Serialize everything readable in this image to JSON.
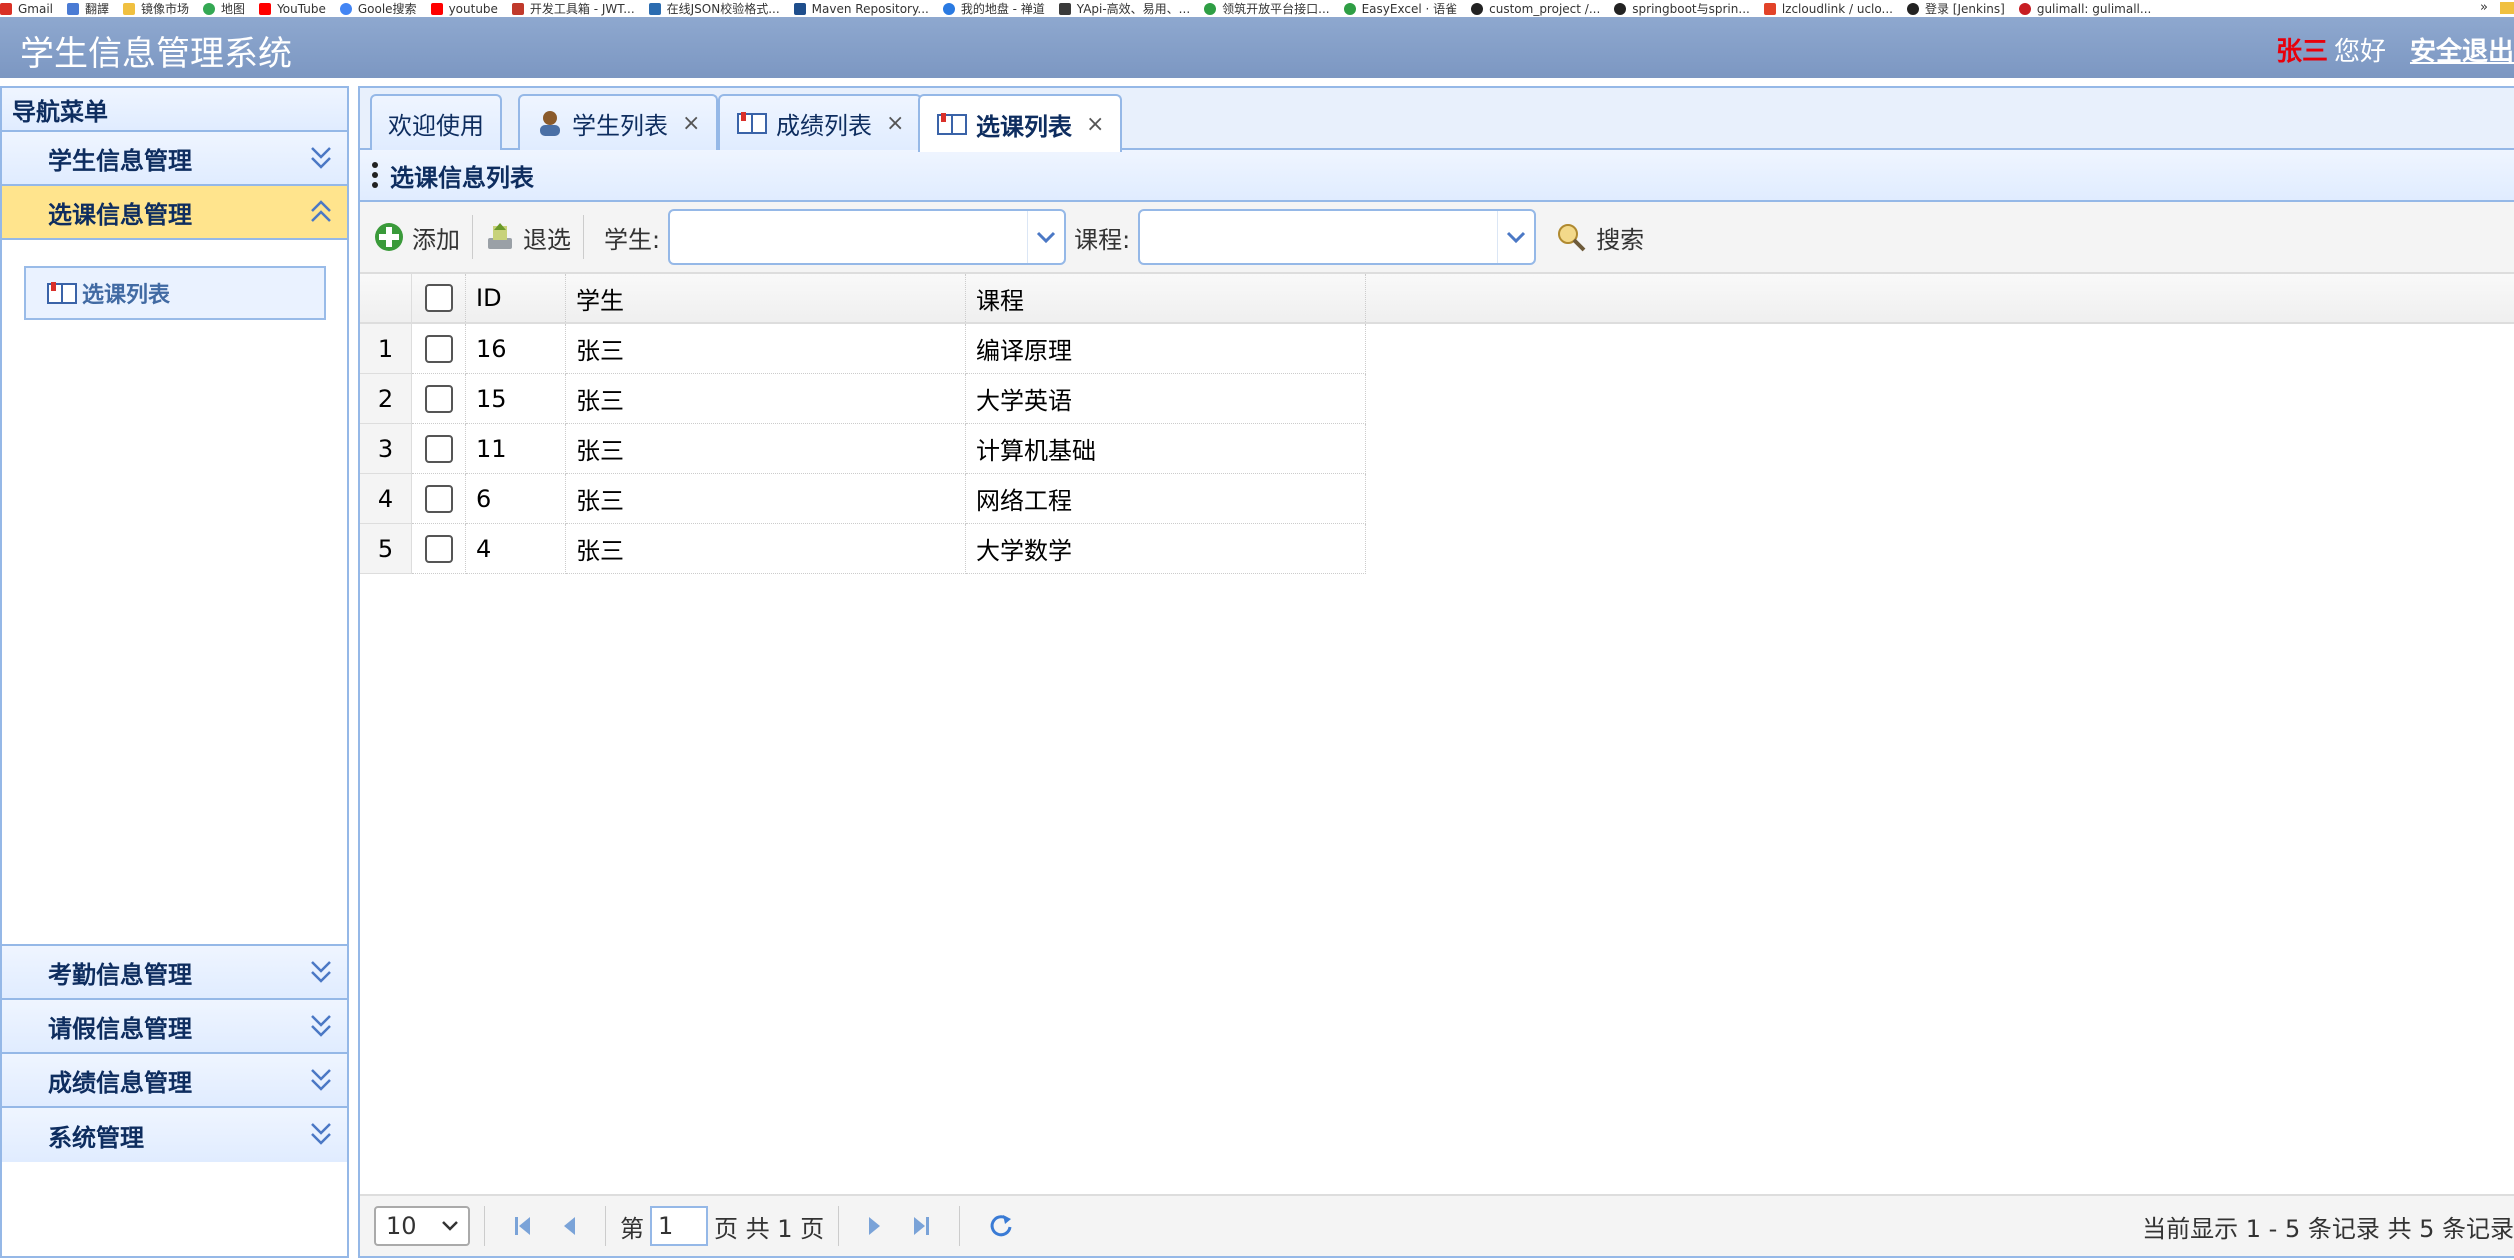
{
  "bookmarks": [
    {
      "label": "Gmail",
      "color": "#d93025"
    },
    {
      "label": "翻譯",
      "color": "#4a7bd4"
    },
    {
      "label": "镜像市场",
      "color": "#f0c040"
    },
    {
      "label": "地图",
      "color": "#34a853"
    },
    {
      "label": "YouTube",
      "color": "#ff0000"
    },
    {
      "label": "Goole搜索",
      "color": "#4285f4"
    },
    {
      "label": "youtube",
      "color": "#ff0000"
    },
    {
      "label": "开发工具箱 - JWT...",
      "color": "#c0392b"
    },
    {
      "label": "在线JSON校验格式...",
      "color": "#2b6cb0"
    },
    {
      "label": "Maven Repository...",
      "color": "#1e4e8c"
    },
    {
      "label": "我的地盘 - 禅道",
      "color": "#2a7ae2"
    },
    {
      "label": "YApi-高效、易用、...",
      "color": "#3a3a3a"
    },
    {
      "label": "领筑开放平台接口...",
      "color": "#2e9e44"
    },
    {
      "label": "EasyExcel · 语雀",
      "color": "#2e9e44"
    },
    {
      "label": "custom_project /...",
      "color": "#222222"
    },
    {
      "label": "springboot与sprin...",
      "color": "#222222"
    },
    {
      "label": "lzcloudlink / uclo...",
      "color": "#e24329"
    },
    {
      "label": "登录 [Jenkins]",
      "color": "#222222"
    },
    {
      "label": "gulimall: gulimall...",
      "color": "#c71d23"
    }
  ],
  "bookmarks_more": "»",
  "header": {
    "title": "学生信息管理系统",
    "user_name": "张三",
    "hello": "您好",
    "logout": "安全退出"
  },
  "sidebar": {
    "title": "导航菜单",
    "sections": [
      {
        "label": "学生信息管理"
      },
      {
        "label": "选课信息管理"
      },
      {
        "label": "考勤信息管理"
      },
      {
        "label": "请假信息管理"
      },
      {
        "label": "成绩信息管理"
      },
      {
        "label": "系统管理"
      }
    ],
    "active_item": "选课列表"
  },
  "tabs": [
    {
      "label": "欢迎使用"
    },
    {
      "label": "学生列表"
    },
    {
      "label": "成绩列表"
    },
    {
      "label": "选课列表"
    }
  ],
  "tab_close": "×",
  "panel": {
    "title": "选课信息列表"
  },
  "toolbar": {
    "add": "添加",
    "withdraw": "退选",
    "student_label": "学生:",
    "course_label": "课程:",
    "search": "搜索"
  },
  "grid": {
    "columns": [
      "ID",
      "学生",
      "课程"
    ],
    "rows": [
      {
        "num": "1",
        "id": "16",
        "student": "张三",
        "course": "编译原理"
      },
      {
        "num": "2",
        "id": "15",
        "student": "张三",
        "course": "大学英语"
      },
      {
        "num": "3",
        "id": "11",
        "student": "张三",
        "course": "计算机基础"
      },
      {
        "num": "4",
        "id": "6",
        "student": "张三",
        "course": "网络工程"
      },
      {
        "num": "5",
        "id": "4",
        "student": "张三",
        "course": "大学数学"
      }
    ]
  },
  "pager": {
    "page_size": "10",
    "page_prefix": "第",
    "page_value": "1",
    "page_suffix": "页 共 1 页",
    "info": "当前显示 1 - 5 条记录 共 5 条记录"
  }
}
